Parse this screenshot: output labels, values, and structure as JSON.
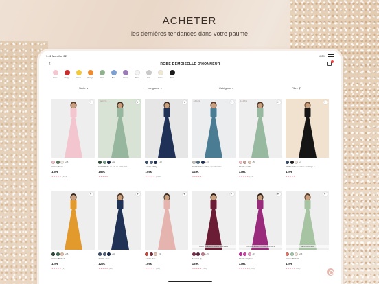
{
  "promo": {
    "headline": "ACHETER",
    "subline": "les dernières tendances dans votre paume"
  },
  "status_bar": {
    "time_date": "9:41  Mon Jun 22",
    "battery": "100%"
  },
  "nav": {
    "back_icon": "chevron-left-icon",
    "title": "ROBE DEMOISELLE D'HONNEUR",
    "cart_icon": "shopping-bag-icon"
  },
  "color_filters": [
    {
      "label": "Rose",
      "hex": "#f3c7cf"
    },
    {
      "label": "Rouge",
      "hex": "#c72d2d"
    },
    {
      "label": "Jaune",
      "hex": "#f2c93a"
    },
    {
      "label": "Orange",
      "hex": "#ee8a2f"
    },
    {
      "label": "Vert",
      "hex": "#8fb28d"
    },
    {
      "label": "Bleu",
      "hex": "#7f9fcf"
    },
    {
      "label": "Violet",
      "hex": "#9a7bb5"
    },
    {
      "label": "Blanc",
      "hex": "#f5f3f2"
    },
    {
      "label": "Gris",
      "hex": "#c9c9c9"
    },
    {
      "label": "Ivoire",
      "hex": "#efe7cf"
    },
    {
      "label": "Noir",
      "hex": "#1b1b1b"
    }
  ],
  "filter_bar": {
    "sort": "Sorte",
    "length": "Longueur",
    "category": "Catégorie",
    "filter": "Filtre"
  },
  "products": [
    {
      "name": "Azazie Kiera",
      "price": "139€",
      "more": "+15",
      "rating_count": "(163)",
      "swatches": [
        "#f4c3cc",
        "#5d7a5d",
        "#f5f0ed"
      ],
      "badge": "",
      "tag": "",
      "bg": "#eeeeee",
      "dress": "#f3c5cf",
      "hair": "#5a3a28"
    },
    {
      "name": "NEW! Robe de bal en satin trés...",
      "price": "159€",
      "more": "+12",
      "rating_count": "",
      "swatches": [
        "#2d4a3a",
        "#7b9f8a",
        "#1f2a4a"
      ],
      "badge": "",
      "tag": "AZAZIE",
      "bg": "#d9e3d5",
      "dress": "#96b79e",
      "hair": "#3a2a20"
    },
    {
      "name": "Azazie Molly",
      "price": "159€",
      "more": "+18",
      "rating_count": "(104)",
      "swatches": [
        "#3b4e6a",
        "#5a6b85",
        "#1e2e52"
      ],
      "badge": "",
      "tag": "",
      "bg": "#e6e6e6",
      "dress": "#1f3156",
      "hair": "#3a2a1f"
    },
    {
      "name": "NEW! Robe entière en satin stre...",
      "price": "149€",
      "more": "+13",
      "rating_count": "",
      "swatches": [
        "#c7c7c7",
        "#4f6f84",
        "#1e2e52"
      ],
      "badge": "",
      "tag": "AZAZIE",
      "bg": "#ecedef",
      "dress": "#4a7d94",
      "hair": "#5a3a28"
    },
    {
      "name": "Azazie Irelch",
      "price": "139€",
      "more": "+56",
      "rating_count": "(55)",
      "swatches": [
        "#f2c2c8",
        "#c3a69c",
        "#e2c8b8"
      ],
      "badge": "",
      "tag": "AZAZIE",
      "bg": "#eeeeee",
      "dress": "#96b9a0",
      "hair": "#4a3020"
    },
    {
      "name": "NEW! Robe Lauréne en crêpe e...",
      "price": "129€",
      "more": "+3",
      "rating_count": "",
      "swatches": [
        "#394b6a",
        "#1e1e1e",
        "#efe5e0"
      ],
      "badge": "",
      "tag": "",
      "bg": "#f1e1cf",
      "dress": "#151515",
      "hair": "#6a4a30"
    },
    {
      "name": "Azazie Barbetti",
      "price": "129€",
      "more": "+15",
      "rating_count": "(1)",
      "swatches": [
        "#2a4a3a",
        "#3d6a52",
        "#e5c3ad"
      ],
      "badge": "",
      "tag": "",
      "bg": "#eeeeee",
      "dress": "#e29a2d",
      "hair": "#3a2618"
    },
    {
      "name": "Azazie Jane",
      "price": "129€",
      "more": "+13",
      "rating_count": "(15)",
      "swatches": [
        "#3a4e6e",
        "#56657e",
        "#1b2c4e"
      ],
      "badge": "",
      "tag": "",
      "bg": "#eeeeee",
      "dress": "#1f3154",
      "hair": "#4a2f1e"
    },
    {
      "name": "Azazie Sue",
      "price": "109€",
      "more": "+9",
      "rating_count": "(58)",
      "swatches": [
        "#c74b3c",
        "#7a2c3a",
        "#e8c3b5"
      ],
      "badge": "",
      "tag": "",
      "bg": "#eeeeee",
      "dress": "#e6b4ae",
      "hair": "#3a2a1e"
    },
    {
      "name": "Azazie Lily",
      "price": "139€",
      "more": "+15",
      "rating_count": "(35)",
      "swatches": [
        "#7d2d4a",
        "#5d2440",
        "#c18090"
      ],
      "badge": "PRIX ÉLÉMENTAIRE SOLDES",
      "tag": "",
      "bg": "#eeeeee",
      "dress": "#6a1d34",
      "hair": "#2e1e14"
    },
    {
      "name": "Azazie Daphne",
      "price": "139€",
      "more": "+15",
      "rating_count": "(115)",
      "swatches": [
        "#c02d9a",
        "#d04aa8",
        "#e8a4c8"
      ],
      "badge": "PRIX ÉLÉMENTAIRE SOLDES",
      "tag": "",
      "bg": "#eeeeee",
      "dress": "#9a2a7c",
      "hair": "#2a1a10"
    },
    {
      "name": "Azazie Mabelle",
      "price": "129€",
      "more": "+16",
      "rating_count": "(50)",
      "swatches": [
        "#e0786a",
        "#a7c9b0",
        "#f3e3dc"
      ],
      "badge": "BESTSELLER",
      "tag": "",
      "bg": "#eeeeee",
      "dress": "#a6c3a2",
      "hair": "#5a3a22"
    }
  ],
  "rating_stars": "★★★★★",
  "chat_icon": "chat-bubble-icon"
}
